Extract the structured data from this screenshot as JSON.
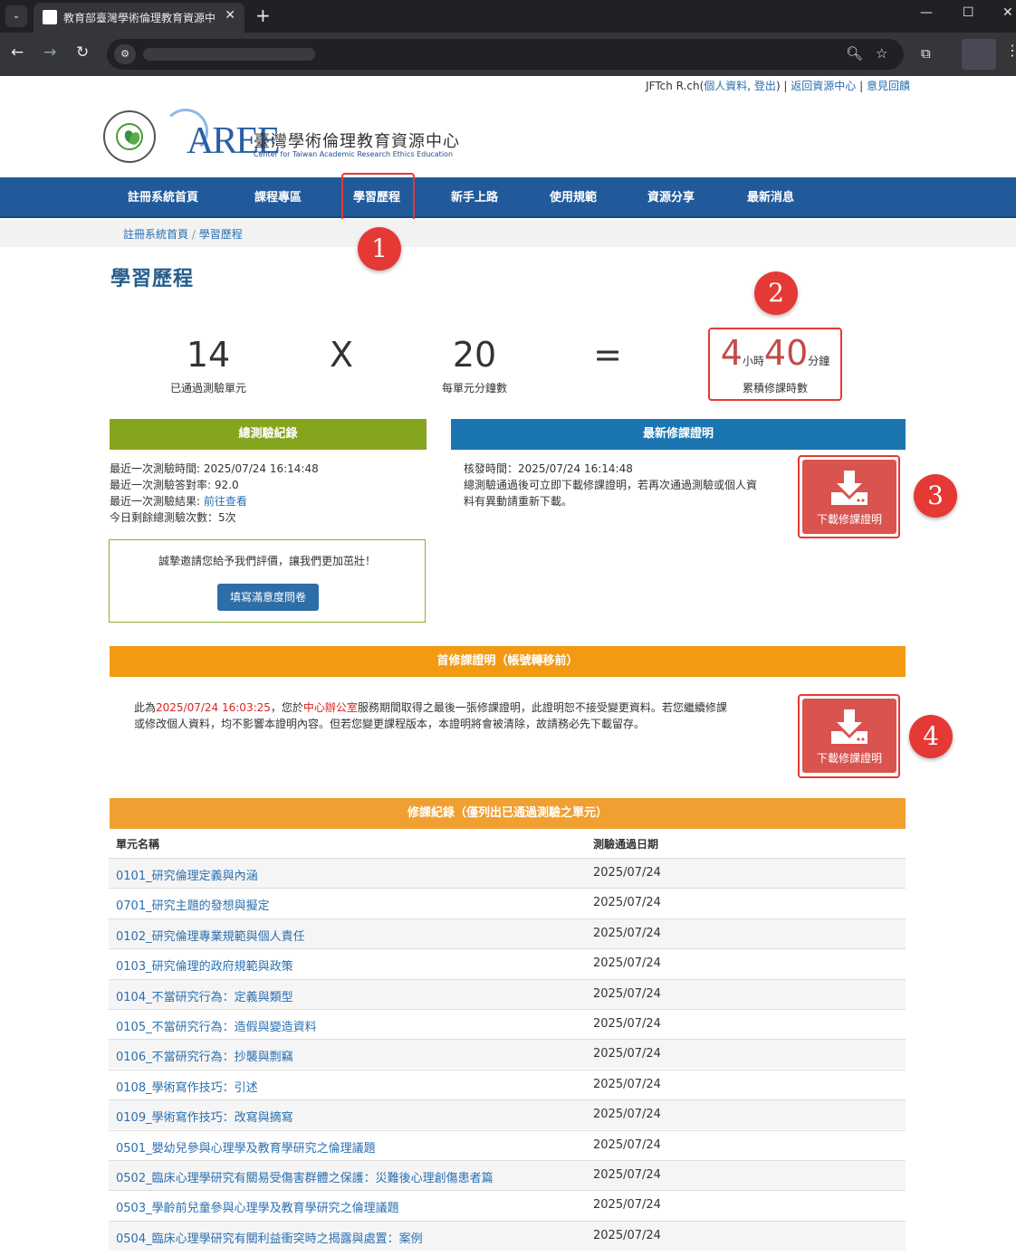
{
  "browser": {
    "tab_title": "教育部臺灣學術倫理教育資源中",
    "tab_close": "✕",
    "new_tab": "+",
    "dropdown": "⌄"
  },
  "user_bar": {
    "prefix": "JFTch R.ch(",
    "profile_link": "個人資料",
    "sep1": ", ",
    "logout_link": "登出",
    "suffix": ") | ",
    "back_link": "返回資源中心",
    "sep2": " | ",
    "feedback_link": "意見回饋"
  },
  "logo": {
    "seal_text": "教育部",
    "word": "AREE",
    "cn": "臺灣學術倫理教育資源中心",
    "en": "Center for Taiwan Academic Research Ethics Education"
  },
  "nav": {
    "items": [
      "註冊系統首頁",
      "課程專區",
      "學習歷程",
      "新手上路",
      "使用規範",
      "資源分享",
      "最新消息"
    ],
    "active_index": 2
  },
  "breadcrumb": {
    "home": "註冊系統首頁",
    "sep": " / ",
    "current": "學習歷程"
  },
  "page_title": "學習歷程",
  "calc": {
    "units_passed": "14",
    "units_passed_label": "已通過測驗單元",
    "times": "X",
    "minutes_per_unit": "20",
    "minutes_per_unit_label": "每單元分鐘數",
    "equals": "=",
    "hours": "4",
    "hours_unit": "小時",
    "minutes": "40",
    "minutes_unit": "分鐘",
    "total_label": "累積修課時數"
  },
  "annotations": [
    "1",
    "2",
    "3",
    "4"
  ],
  "test_record": {
    "header": "總測驗紀錄",
    "last_time": "最近一次測驗時間: 2025/07/24 16:14:48",
    "last_rate": "最近一次測驗答對率: 92.0",
    "last_result_label": "最近一次測驗結果: ",
    "last_result_link": "前往查看",
    "remaining": "今日剩餘總測驗次數：5次"
  },
  "survey": {
    "text": "誠摯邀請您給予我們評價，讓我們更加茁壯！",
    "button": "填寫滿意度問卷"
  },
  "latest_cert": {
    "header": "最新修課證明",
    "issued": "核發時間：2025/07/24 16:14:48",
    "note_line1": "總測驗通過後可立即下載修課證明，若再次通過測驗或個人資",
    "note_line2": "料有異動請重新下載。",
    "download": "下載修課證明"
  },
  "first_cert": {
    "header": "首修課證明（帳號轉移前）",
    "t1": "此為",
    "date": "2025/07/24 16:03:25",
    "t2": "，您於",
    "office": "中心辦公室",
    "t3": "服務期間取得之最後一張修課證明，此證明恕不接受變更資料。若您繼續修課",
    "line2": "或修改個人資料，均不影響本證明內容。但若您變更課程版本，本證明將會被清除，故請務必先下載留存。",
    "download": "下載修課證明"
  },
  "course_record": {
    "header": "修課紀錄（僅列出已通過測驗之單元）",
    "col_name": "單元名稱",
    "col_date": "測驗通過日期",
    "rows": [
      {
        "name": "0101_研究倫理定義與內涵",
        "date": "2025/07/24"
      },
      {
        "name": "0701_研究主題的發想與擬定",
        "date": "2025/07/24"
      },
      {
        "name": "0102_研究倫理專業規範與個人責任",
        "date": "2025/07/24"
      },
      {
        "name": "0103_研究倫理的政府規範與政策",
        "date": "2025/07/24"
      },
      {
        "name": "0104_不當研究行為：定義與類型",
        "date": "2025/07/24"
      },
      {
        "name": "0105_不當研究行為：造假與變造資料",
        "date": "2025/07/24"
      },
      {
        "name": "0106_不當研究行為：抄襲與剽竊",
        "date": "2025/07/24"
      },
      {
        "name": "0108_學術寫作技巧：引述",
        "date": "2025/07/24"
      },
      {
        "name": "0109_學術寫作技巧：改寫與摘寫",
        "date": "2025/07/24"
      },
      {
        "name": "0501_嬰幼兒參與心理學及教育學研究之倫理議題",
        "date": "2025/07/24"
      },
      {
        "name": "0502_臨床心理學研究有關易受傷害群體之保護：災難後心理創傷患者篇",
        "date": "2025/07/24"
      },
      {
        "name": "0503_學齡前兒童參與心理學及教育學研究之倫理議題",
        "date": "2025/07/24"
      },
      {
        "name": "0504_臨床心理學研究有關利益衝突時之揭露與處置：案例",
        "date": "2025/07/24"
      }
    ]
  },
  "colors": {
    "nav_bg": "#215a9b",
    "green_head": "#86a51f",
    "blue_head": "#1b75b0",
    "orange_head": "#f39a12",
    "orange2_head": "#f0a030",
    "download_btn": "#d9534f",
    "annotation_red": "#e53935"
  }
}
